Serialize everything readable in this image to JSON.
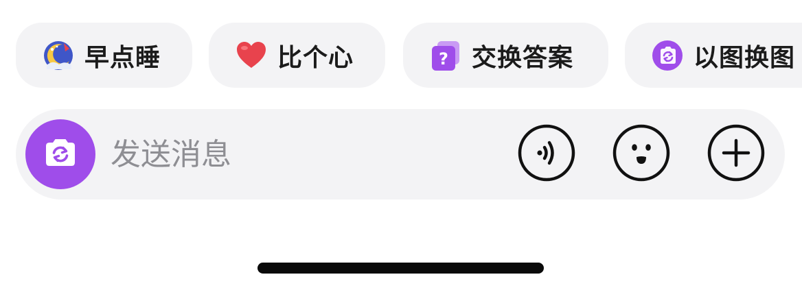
{
  "quick_actions": [
    {
      "label": "早点睡",
      "icon": "moon-sleep-icon"
    },
    {
      "label": "比个心",
      "icon": "heart-icon"
    },
    {
      "label": "交换答案",
      "icon": "question-cards-icon"
    },
    {
      "label": "以图换图",
      "icon": "image-swap-icon"
    }
  ],
  "composer": {
    "placeholder": "发送消息",
    "value": "",
    "left_icon": "camera-swap-icon",
    "right_icons": [
      "voice-icon",
      "emoji-icon",
      "plus-icon"
    ]
  },
  "colors": {
    "accent": "#9f4dea",
    "chip_background": "#f3f3f5",
    "text": "#1b1b1b",
    "placeholder": "#8e8e93",
    "heart": "#e8434d"
  }
}
